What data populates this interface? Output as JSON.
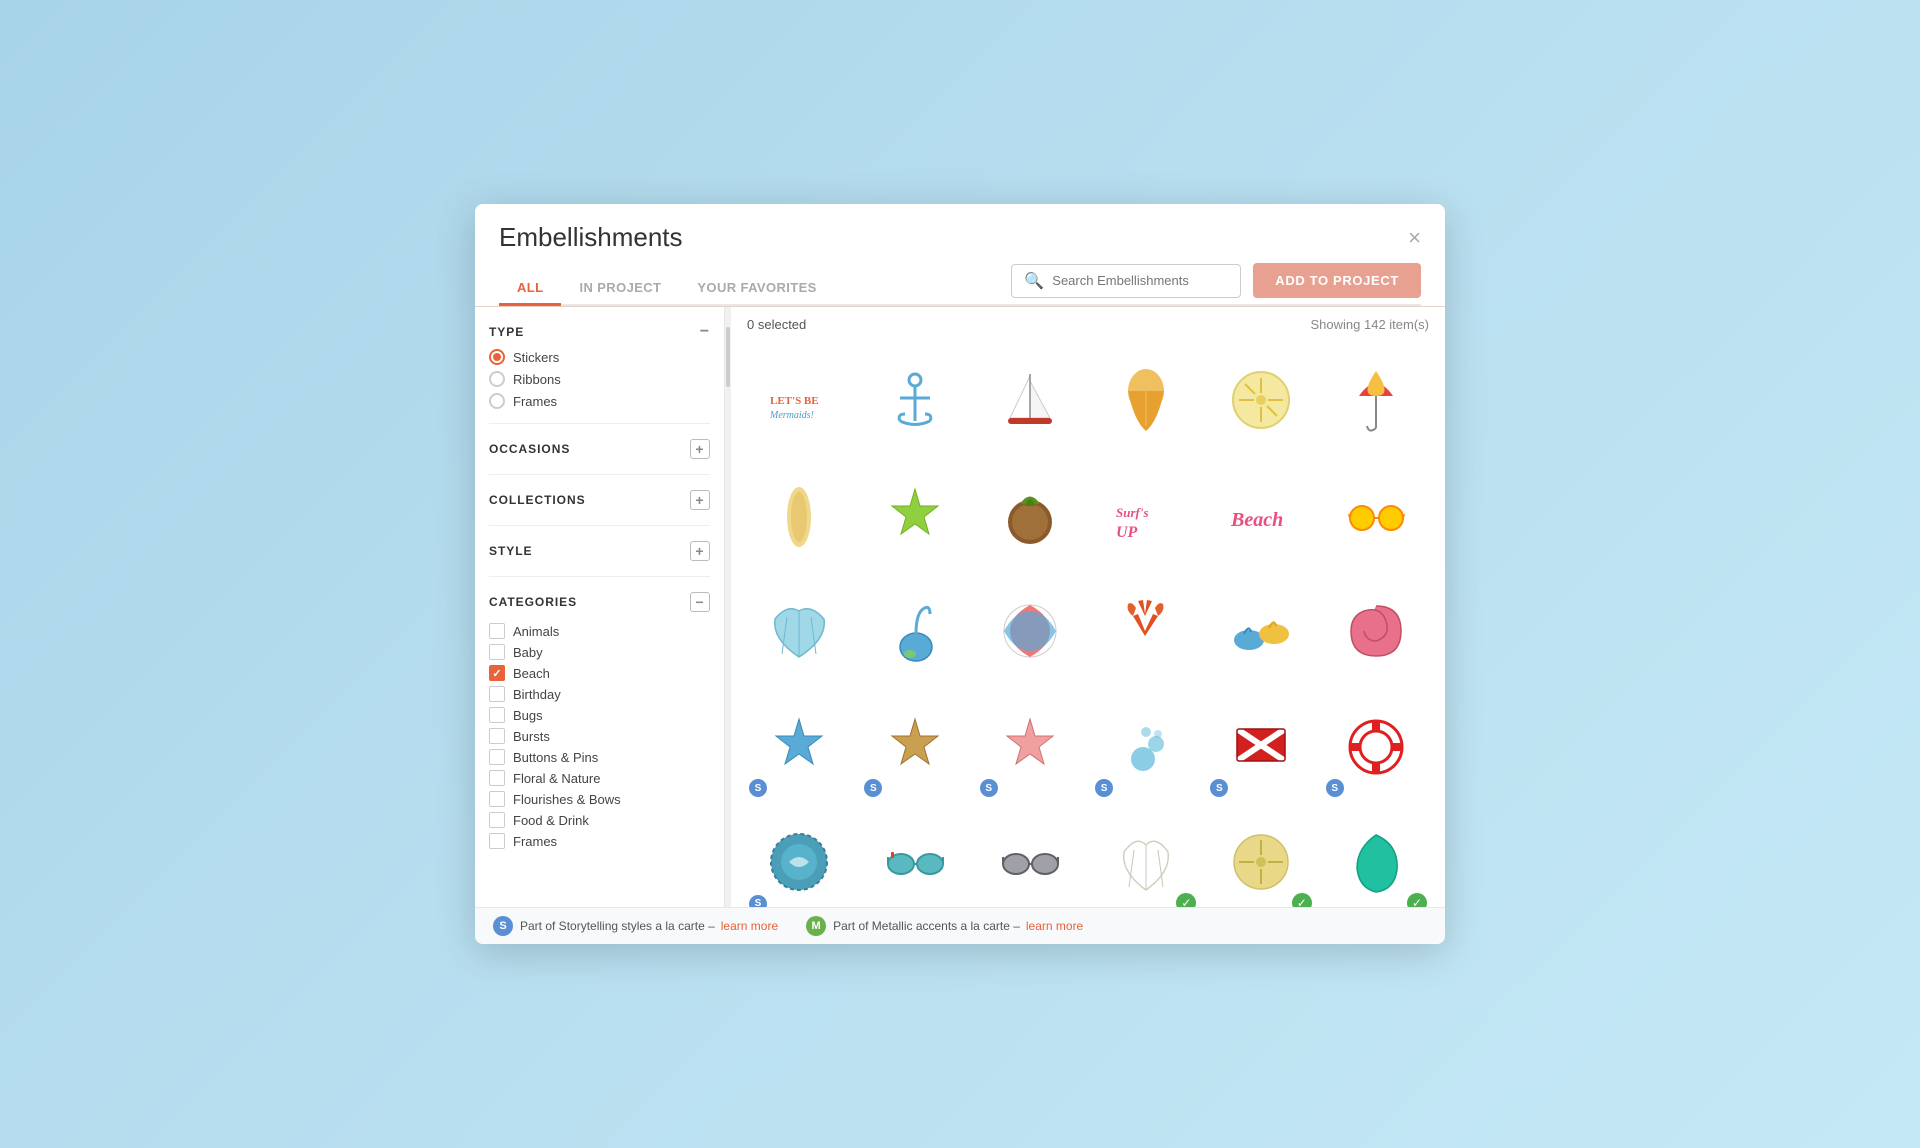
{
  "modal": {
    "title": "Embellishments",
    "close_label": "×",
    "tabs": [
      {
        "id": "all",
        "label": "ALL",
        "active": true
      },
      {
        "id": "in-project",
        "label": "IN PROJECT",
        "active": false
      },
      {
        "id": "your-favorites",
        "label": "YOUR FAVORITES",
        "active": false
      }
    ],
    "search": {
      "placeholder": "Search Embellishments"
    },
    "add_button_label": "ADD TO PROJECT"
  },
  "sidebar": {
    "type_section_label": "TYPE",
    "type_options": [
      {
        "id": "stickers",
        "label": "Stickers",
        "checked": true
      },
      {
        "id": "ribbons",
        "label": "Ribbons",
        "checked": false
      },
      {
        "id": "frames",
        "label": "Frames",
        "checked": false
      }
    ],
    "occasions_label": "OCCASIONS",
    "collections_label": "COLLECTIONS",
    "style_label": "STYLE",
    "categories_label": "CATEGORIES",
    "categories": [
      {
        "id": "animals",
        "label": "Animals",
        "checked": false
      },
      {
        "id": "baby",
        "label": "Baby",
        "checked": false
      },
      {
        "id": "beach",
        "label": "Beach",
        "checked": true
      },
      {
        "id": "birthday",
        "label": "Birthday",
        "checked": false
      },
      {
        "id": "bugs",
        "label": "Bugs",
        "checked": false
      },
      {
        "id": "bursts",
        "label": "Bursts",
        "checked": false
      },
      {
        "id": "buttons-pins",
        "label": "Buttons & Pins",
        "checked": false
      },
      {
        "id": "floral-nature",
        "label": "Floral & Nature",
        "checked": false
      },
      {
        "id": "flourishes-bows",
        "label": "Flourishes & Bows",
        "checked": false
      },
      {
        "id": "food-drink",
        "label": "Food & Drink",
        "checked": false
      },
      {
        "id": "frames",
        "label": "Frames",
        "checked": false
      }
    ]
  },
  "content": {
    "selected_count": "0 selected",
    "showing_count": "Showing 142 item(s)"
  },
  "footer": {
    "s_badge_label": "S",
    "s_text": "Part of Storytelling styles a la carte –",
    "s_link": "learn more",
    "m_badge_label": "M",
    "m_text": "Part of Metallic accents a la carte –",
    "m_link": "learn more"
  }
}
